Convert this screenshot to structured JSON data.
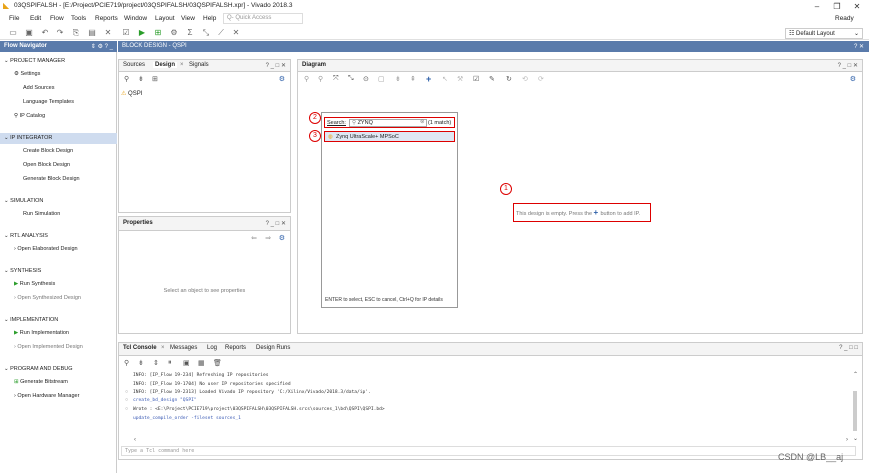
{
  "title_bar": {
    "title": "03QSPIFALSH - [E:/Project/PCIE719/project/03QSPIFALSH/03QSPIFALSH.xpr] - Vivado 2018.3",
    "minimize": "–",
    "maximize": "❐",
    "close": "✕"
  },
  "menu": {
    "items": [
      "File",
      "Edit",
      "Flow",
      "Tools",
      "Reports",
      "Window",
      "Layout",
      "View",
      "Help"
    ],
    "quick_access_placeholder": "Q- Quick Access",
    "status": "Ready"
  },
  "toolbar": {
    "layout_selector": "Default Layout"
  },
  "flow_navigator": {
    "header": "Flow Navigator",
    "sections": [
      {
        "title": "PROJECT MANAGER",
        "items": [
          "Settings",
          "Add Sources",
          "Language Templates",
          "IP Catalog"
        ]
      },
      {
        "title": "IP INTEGRATOR",
        "items": [
          "Create Block Design",
          "Open Block Design",
          "Generate Block Design"
        ]
      },
      {
        "title": "SIMULATION",
        "items": [
          "Run Simulation"
        ]
      },
      {
        "title": "RTL ANALYSIS",
        "items": [
          "Open Elaborated Design"
        ]
      },
      {
        "title": "SYNTHESIS",
        "items": [
          "Run Synthesis",
          "Open Synthesized Design"
        ]
      },
      {
        "title": "IMPLEMENTATION",
        "items": [
          "Run Implementation",
          "Open Implemented Design"
        ]
      },
      {
        "title": "PROGRAM AND DEBUG",
        "items": [
          "Generate Bitstream",
          "Open Hardware Manager"
        ]
      }
    ]
  },
  "block_design": {
    "header": "BLOCK DESIGN - QSPI",
    "help": "? ✕"
  },
  "sources_panel": {
    "tabs": [
      "Sources",
      "Design",
      "Signals"
    ],
    "tree_item": "QSPI",
    "controls": "? _ □ ✕"
  },
  "properties_panel": {
    "title": "Properties",
    "placeholder": "Select an object to see properties",
    "controls": "? _ □ ✕"
  },
  "diagram_panel": {
    "title": "Diagram",
    "controls": "? _ □ ✕",
    "empty_message": "This design is empty. Press the",
    "empty_message_end": "button to add IP."
  },
  "search_popup": {
    "label": "Search:",
    "value": "ZYNQ",
    "match_count": "(1 match)",
    "result": "Zynq UltraScale+ MPSoC",
    "hint": "ENTER to select, ESC to cancel, Ctrl+Q for IP details"
  },
  "callouts": [
    "1",
    "2",
    "3"
  ],
  "tcl_panel": {
    "tabs": [
      "Tcl Console",
      "Messages",
      "Log",
      "Reports",
      "Design Runs"
    ],
    "controls": "? _ □ □",
    "lines": [
      "INFO: [IP_Flow 19-234] Refreshing IP repositories",
      "INFO: [IP_Flow 19-1704] No user IP repositories specified",
      "INFO: [IP_Flow 19-2313] Loaded Vivado IP repository 'C:/Xilinx/Vivado/2018.3/data/ip'.",
      "create_bd_design \"QSPI\"",
      "Wrote  : <E:\\Project\\PCIE719\\project\\03QSPIFALSH\\03QSPIFALSH.srcs\\sources_1\\bd\\QSPI\\QSPI.bd>",
      "update_compile_order -fileset sources_1"
    ],
    "input_placeholder": "Type a Tcl command here"
  },
  "watermark": "CSDN @LB__aj"
}
